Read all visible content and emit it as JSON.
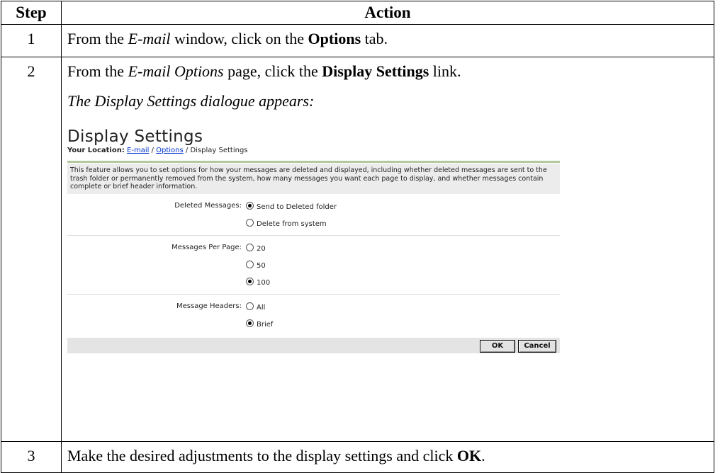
{
  "header": {
    "step": "Step",
    "action": "Action"
  },
  "rows": [
    {
      "num": "1",
      "pre": "From the ",
      "em": "E-mail",
      "mid": " window, click on the ",
      "strong": "Options",
      "post": " tab."
    },
    {
      "num": "2",
      "pre": "From the ",
      "em": "E-mail Options",
      "mid": " page, click the ",
      "strong": "Display Settings",
      "post": " link.",
      "caption": "The Display Settings dialogue appears:"
    },
    {
      "num": "3",
      "pre": "Make the desired adjustments to the display settings and click ",
      "strong": "OK",
      "post": "."
    }
  ],
  "dialog": {
    "title": "Display Settings",
    "location_label": "Your Location:",
    "crumb_email": "E-mail",
    "crumb_sep1": " / ",
    "crumb_options": "Options",
    "crumb_sep2": " / Display Settings",
    "intro": "This feature allows you to set options for how your messages are deleted and displayed, including whether deleted messages are sent to the trash folder or permanently removed from the system, how many messages you want each page to display, and whether messages contain complete or brief header information.",
    "deleted": {
      "label": "Deleted Messages:",
      "options": [
        "Send to Deleted folder",
        "Delete from system"
      ],
      "selected": "Send to Deleted folder"
    },
    "per_page": {
      "label": "Messages Per Page:",
      "options": [
        "20",
        "50",
        "100"
      ],
      "selected": "100"
    },
    "headers": {
      "label": "Message Headers:",
      "options": [
        "All",
        "Brief"
      ],
      "selected": "Brief"
    },
    "ok": "OK",
    "cancel": "Cancel"
  }
}
